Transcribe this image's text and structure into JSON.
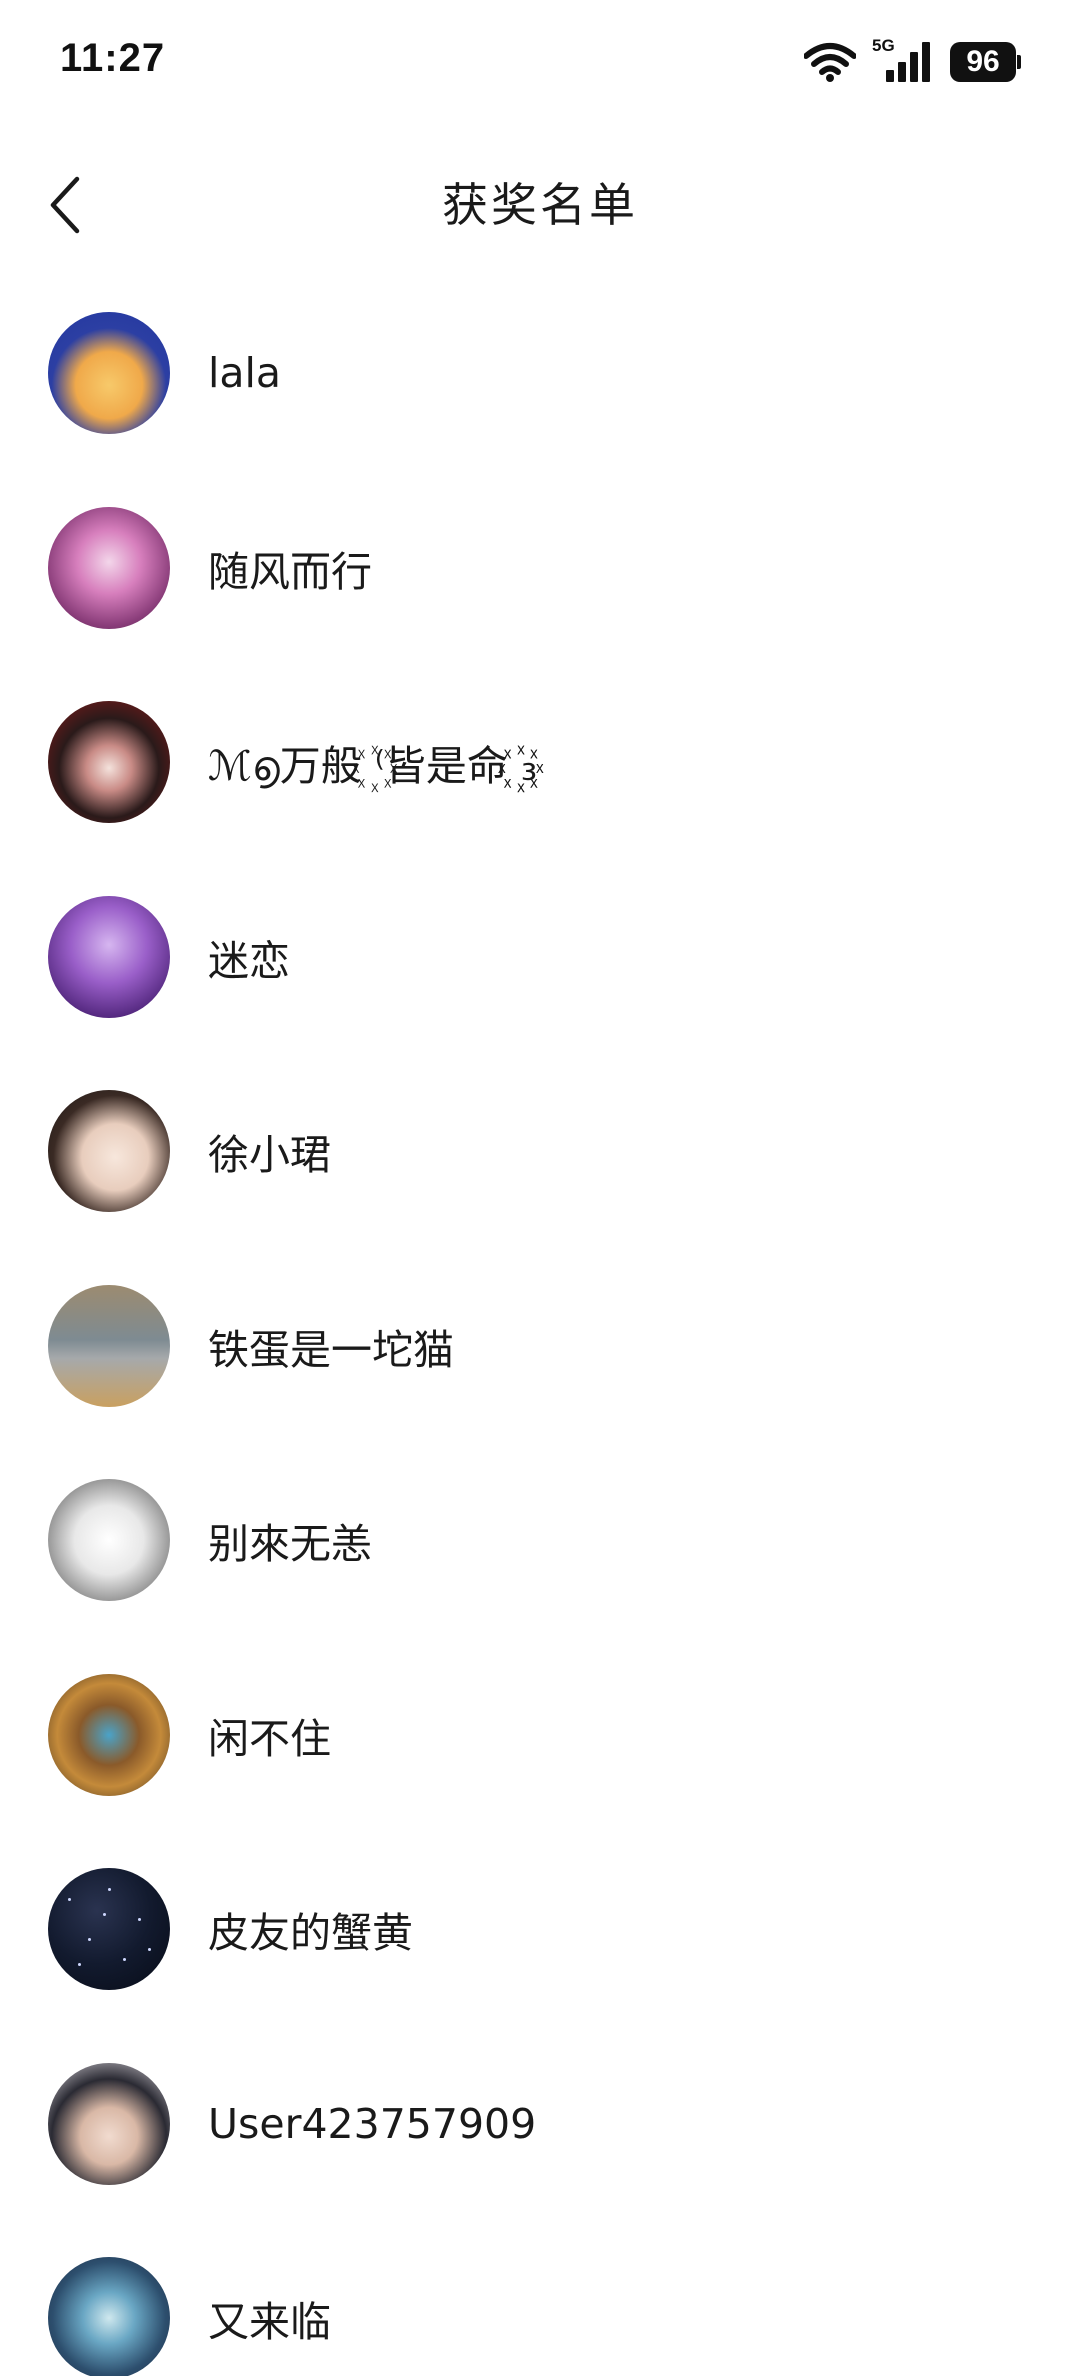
{
  "status_bar": {
    "time": "11:27",
    "network": "5G",
    "battery": "96",
    "icons": [
      "wifi-icon",
      "signal-icon",
      "battery-icon"
    ]
  },
  "nav": {
    "title": "获奖名单",
    "back_icon": "chevron-left-icon"
  },
  "winners": [
    {
      "name": "lala",
      "avatar": "anime-girl-avatar"
    },
    {
      "name": "随风而行",
      "avatar": "pink-anime-avatar"
    },
    {
      "name": "ℳ൭万般 ꙰⁽皆是命 ꙰꙰꙰₃",
      "avatar": "gothic-anime-avatar"
    },
    {
      "name": "迷恋",
      "avatar": "purple-tree-avatar"
    },
    {
      "name": "徐小珺",
      "avatar": "portrait-avatar"
    },
    {
      "name": "铁蛋是一坨猫",
      "avatar": "cat-avatar"
    },
    {
      "name": "别來无恙",
      "avatar": "ink-painting-avatar"
    },
    {
      "name": "闲不住",
      "avatar": "game-hero-avatar"
    },
    {
      "name": "皮友的蟹黄",
      "avatar": "night-sky-avatar"
    },
    {
      "name": "User423757909",
      "avatar": "anime-boy-avatar"
    },
    {
      "name": "又来临",
      "avatar": "silver-hair-avatar"
    }
  ],
  "colors": {
    "background": "#ffffff",
    "text": "#1a1a1a"
  }
}
